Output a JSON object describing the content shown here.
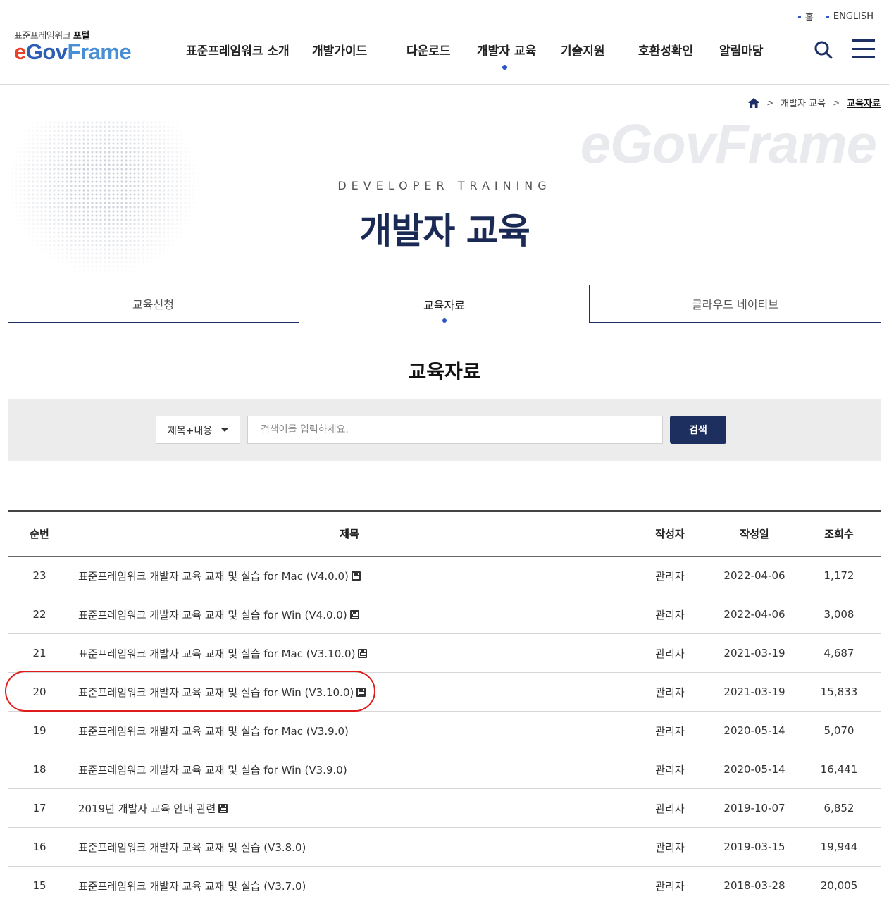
{
  "header": {
    "util_links": [
      "홈",
      "ENGLISH"
    ],
    "logo_sub_prefix": "표준프레임워크",
    "logo_sub_bold": "포털",
    "logo_main_e": "e",
    "logo_main_gov": "Gov",
    "logo_main_frame": "Frame",
    "nav": [
      "표준프레임워크 소개",
      "개발가이드",
      "다운로드",
      "개발자 교육",
      "기술지원",
      "호환성확인",
      "알림마당"
    ],
    "nav_active": "개발자 교육",
    "icons": [
      "search-icon",
      "hamburger-menu-icon"
    ],
    "accent_color": "#2f56c8",
    "navy_color": "#1d2f66"
  },
  "breadcrumb": {
    "items": [
      "개발자 교육",
      "교육자료"
    ]
  },
  "hero": {
    "watermark": "eGovFrame",
    "subtitle": "DEVELOPER TRAINING",
    "title": "개발자 교육"
  },
  "tabs": [
    "교육신청",
    "교육자료",
    "클라우드 네이티브"
  ],
  "tab_active": "교육자료",
  "section_title": "교육자료",
  "search": {
    "select_value": "제목+내용",
    "placeholder": "검색어를 입력하세요.",
    "button": "검색"
  },
  "table": {
    "headers": [
      "순번",
      "제목",
      "작성자",
      "작성일",
      "조회수"
    ],
    "rows": [
      {
        "no": "23",
        "title": "표준프레임워크 개발자 교육 교재 및 실습 for Mac (V4.0.0)",
        "attachment": true,
        "author": "관리자",
        "date": "2022-04-06",
        "views": "1,172"
      },
      {
        "no": "22",
        "title": "표준프레임워크 개발자 교육 교재 및 실습 for Win (V4.0.0)",
        "attachment": true,
        "author": "관리자",
        "date": "2022-04-06",
        "views": "3,008"
      },
      {
        "no": "21",
        "title": "표준프레임워크 개발자 교육 교재 및 실습 for Mac (V3.10.0)",
        "attachment": true,
        "author": "관리자",
        "date": "2021-03-19",
        "views": "4,687"
      },
      {
        "no": "20",
        "title": "표준프레임워크 개발자 교육 교재 및 실습 for Win (V3.10.0)",
        "attachment": true,
        "author": "관리자",
        "date": "2021-03-19",
        "views": "15,833"
      },
      {
        "no": "19",
        "title": "표준프레임워크 개발자 교육 교재 및 실습 for Mac (V3.9.0)",
        "attachment": false,
        "author": "관리자",
        "date": "2020-05-14",
        "views": "5,070"
      },
      {
        "no": "18",
        "title": "표준프레임워크 개발자 교육 교재 및 실습 for Win (V3.9.0)",
        "attachment": false,
        "author": "관리자",
        "date": "2020-05-14",
        "views": "16,441"
      },
      {
        "no": "17",
        "title": "2019년 개발자 교육 안내 관련",
        "attachment": true,
        "author": "관리자",
        "date": "2019-10-07",
        "views": "6,852"
      },
      {
        "no": "16",
        "title": "표준프레임워크 개발자 교육 교재 및 실습 (V3.8.0)",
        "attachment": false,
        "author": "관리자",
        "date": "2019-03-15",
        "views": "19,944"
      },
      {
        "no": "15",
        "title": "표준프레임워크 개발자 교육 교재 및 실습 (V3.7.0)",
        "attachment": false,
        "author": "관리자",
        "date": "2018-03-28",
        "views": "20,005"
      }
    ],
    "highlighted_row_no": "20",
    "highlight_color": "#e01b1b"
  }
}
